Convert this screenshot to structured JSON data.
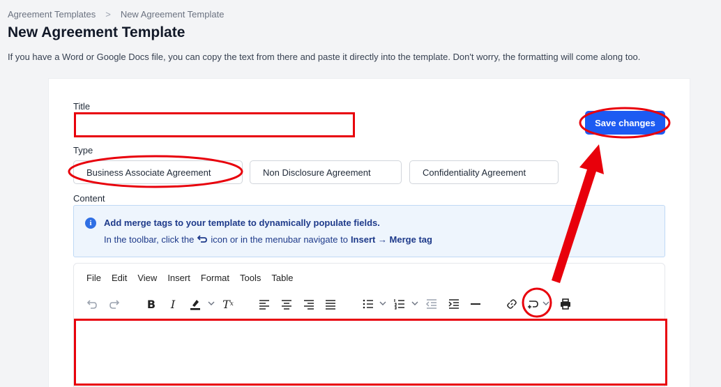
{
  "breadcrumb": {
    "parent": "Agreement Templates",
    "separator": ">",
    "current": "New Agreement Template"
  },
  "page": {
    "title": "New Agreement Template",
    "description": "If you have a Word or Google Docs file, you can copy the text from there and paste it directly into the template. Don't worry, the formatting will come along too."
  },
  "form": {
    "title_label": "Title",
    "title_value": "",
    "type_label": "Type",
    "types": [
      "Business Associate Agreement",
      "Non Disclosure Agreement",
      "Confidentiality Agreement"
    ],
    "selected_type": "Business Associate Agreement",
    "content_label": "Content",
    "save_label": "Save changes"
  },
  "info": {
    "title": "Add merge tags to your template to dynamically populate fields.",
    "text_before": "In the toolbar, click the",
    "text_middle": "icon or in the menubar navigate to",
    "path": "Insert → Merge tag"
  },
  "editor": {
    "menu": [
      "File",
      "Edit",
      "View",
      "Insert",
      "Format",
      "Tools",
      "Table"
    ],
    "toolbar_icons": [
      "undo-icon",
      "redo-icon",
      "bold-icon",
      "italic-icon",
      "highlight-icon",
      "clear-format-icon",
      "align-left-icon",
      "align-center-icon",
      "align-right-icon",
      "justify-icon",
      "bullet-list-icon",
      "numbered-list-icon",
      "outdent-icon",
      "indent-icon",
      "horizontal-rule-icon",
      "link-icon",
      "merge-tag-icon",
      "print-icon"
    ]
  },
  "colors": {
    "accent": "#1d5bf2",
    "annotation": "#e8000b",
    "info_bg": "#eef5fd"
  }
}
